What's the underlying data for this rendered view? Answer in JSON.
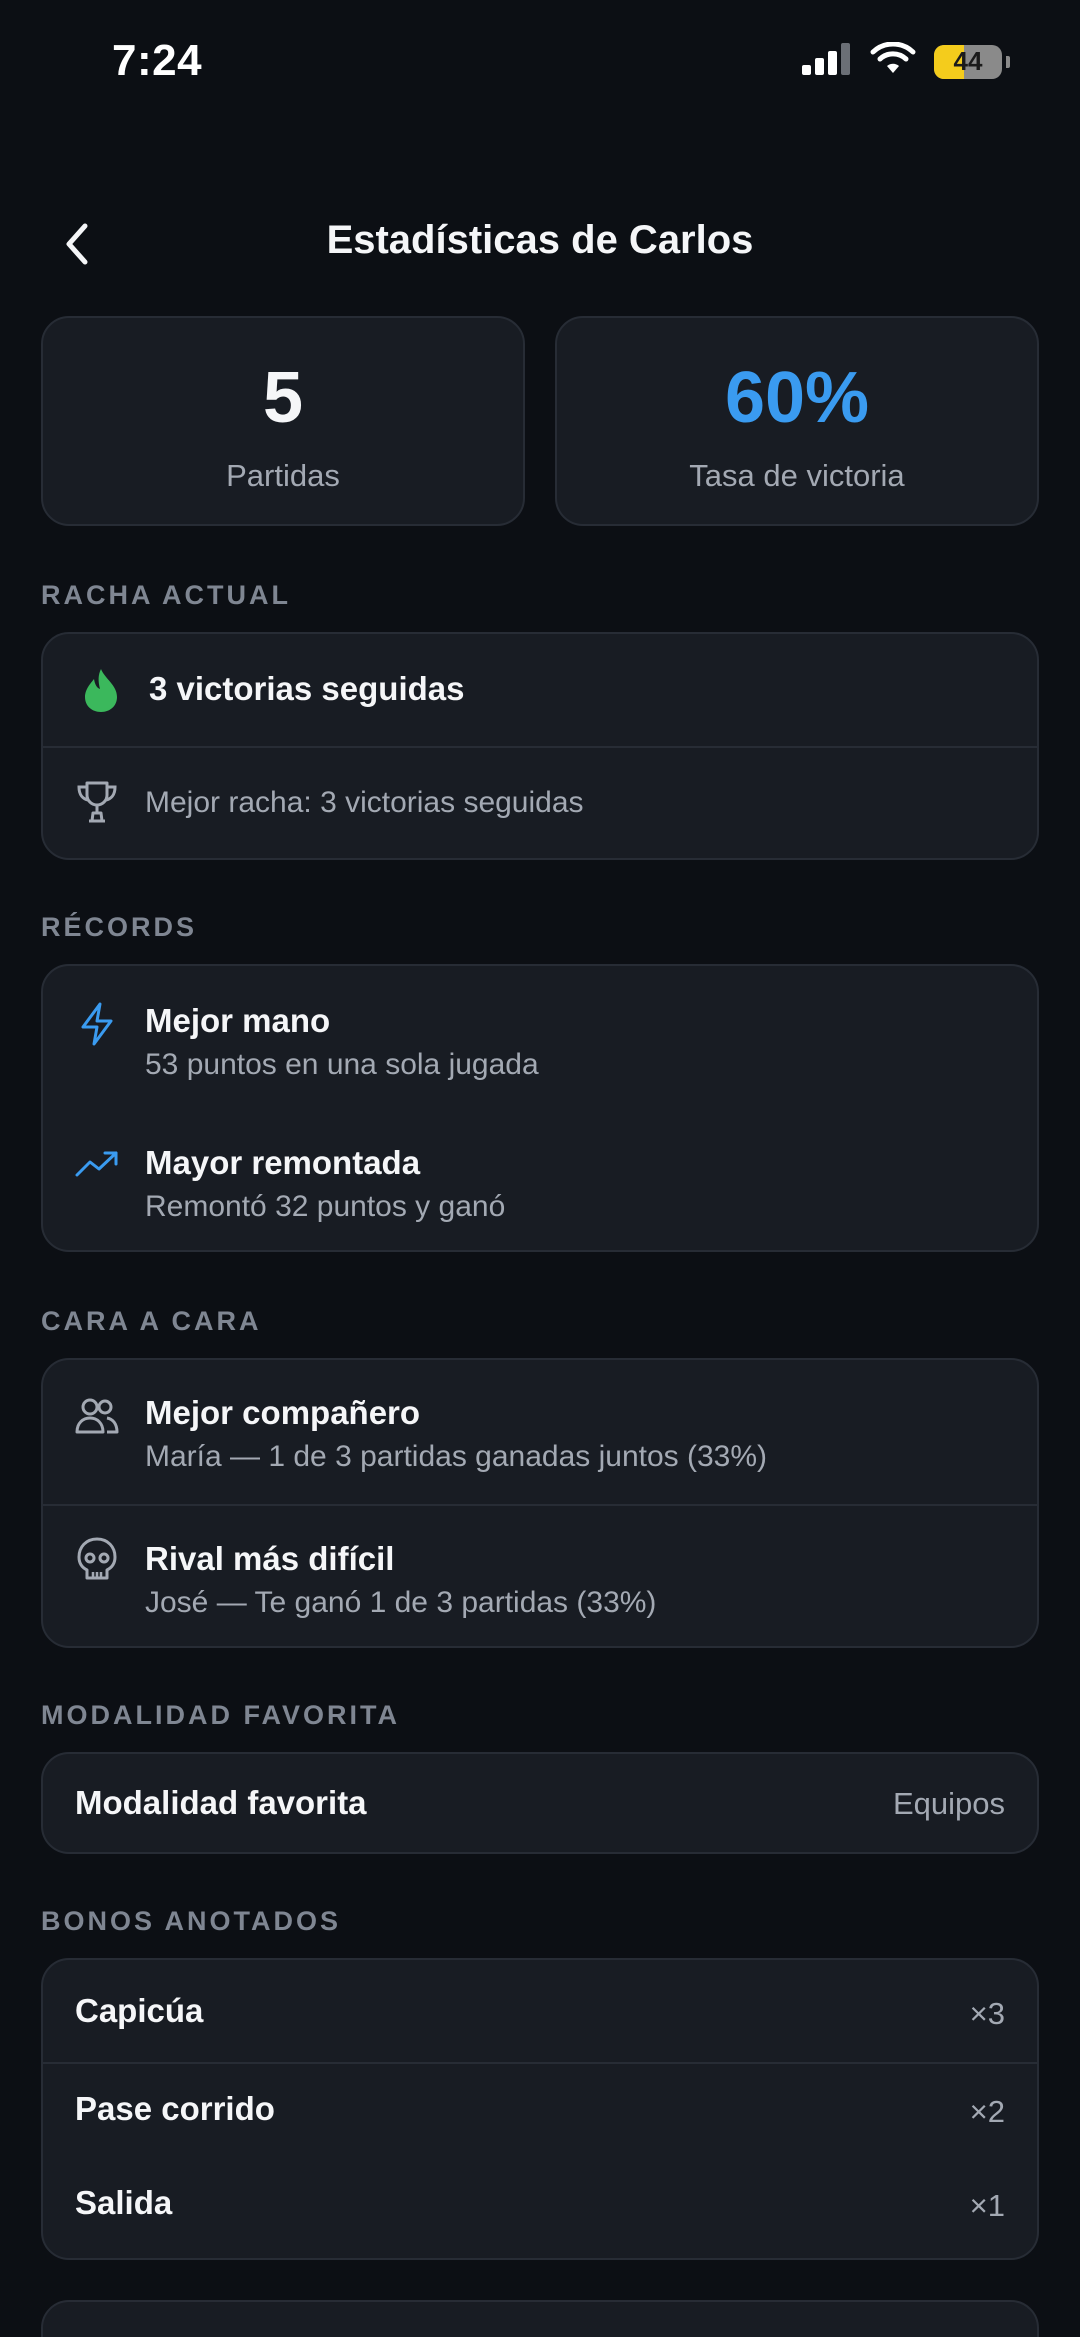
{
  "status_bar": {
    "time": "7:24",
    "battery": "44",
    "battery_level": 0.44
  },
  "header": {
    "title": "Estadísticas de Carlos"
  },
  "stats": {
    "games_value": "5",
    "games_label": "Partidas",
    "winrate_value": "60%",
    "winrate_label": "Tasa de victoria"
  },
  "streak": {
    "section": "RACHA ACTUAL",
    "current": "3 victorias seguidas",
    "best": "Mejor racha: 3 victorias seguidas"
  },
  "records": {
    "section": "RÉCORDS",
    "items": [
      {
        "title": "Mejor mano",
        "subtitle": "53 puntos en una sola jugada",
        "icon": "lightning-icon"
      },
      {
        "title": "Mayor remontada",
        "subtitle": "Remontó 32 puntos y ganó",
        "icon": "trending-up-icon"
      }
    ]
  },
  "head_to_head": {
    "section": "CARA A CARA",
    "items": [
      {
        "title": "Mejor compañero",
        "subtitle": "María — 1 de 3 partidas ganadas juntos (33%)",
        "icon": "users-icon"
      },
      {
        "title": "Rival más difícil",
        "subtitle": "José — Te ganó 1 de 3 partidas (33%)",
        "icon": "skull-icon"
      }
    ]
  },
  "favorite_mode": {
    "section": "MODALIDAD FAVORITA",
    "label": "Modalidad favorita",
    "value": "Equipos"
  },
  "bonuses": {
    "section": "BONOS ANOTADOS",
    "items": [
      {
        "label": "Capicúa",
        "count": "×3"
      },
      {
        "label": "Pase corrido",
        "count": "×2"
      },
      {
        "label": "Salida",
        "count": "×1"
      }
    ]
  },
  "colors": {
    "accent": "#3a9bf0",
    "flame": "#3bb85c",
    "background": "#0c0f14",
    "card": "#181c23"
  }
}
